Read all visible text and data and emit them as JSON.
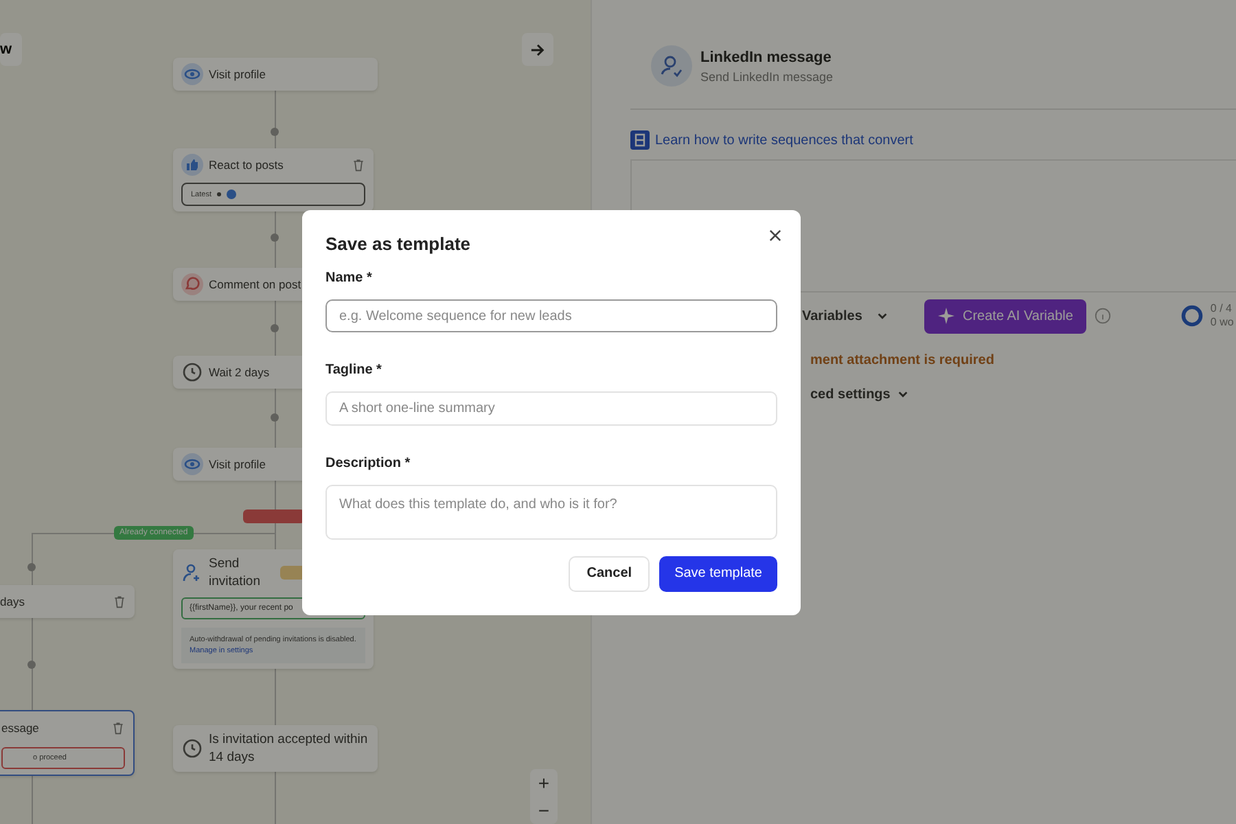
{
  "canvas": {
    "back_label": "w",
    "nodes": [
      {
        "kind": "visit",
        "label": "Visit profile"
      },
      {
        "kind": "react",
        "label": "React to posts",
        "deletable": true,
        "select": "Latest"
      },
      {
        "kind": "comment",
        "label": "Comment on post"
      },
      {
        "kind": "wait",
        "label": "Wait 2 days"
      },
      {
        "kind": "visit",
        "label": "Visit profile"
      },
      {
        "kind": "cut",
        "label": "days",
        "deletable": true,
        "selected": false
      },
      {
        "kind": "invite",
        "label": "Send invitation",
        "field": "{{firstName}}, your recent po",
        "note": "Auto-withdrawal of pending invitations is disabled.",
        "note_link": "Manage in settings"
      },
      {
        "kind": "cut",
        "label": "essage",
        "deletable": true,
        "selected": true,
        "error_field": "o proceed"
      },
      {
        "kind": "wait",
        "label": "Is invitation accepted within 14 days"
      }
    ],
    "branches": [
      {
        "kind": "connected",
        "label": "Already connected"
      },
      {
        "kind": "not_connected"
      }
    ],
    "zoom": [
      "+",
      "−"
    ]
  },
  "panel": {
    "title": "LinkedIn message",
    "subtitle": "Send LinkedIn message",
    "help_link": "Learn how to write sequences that convert",
    "variables": "Variables",
    "ai_button": "Create AI Variable",
    "counter_top": "0 / 4",
    "counter_bottom": "0 wo",
    "error": "ment attachment is required",
    "advanced": "ced settings"
  },
  "modal": {
    "title": "Save as template",
    "fields": [
      {
        "kind": "input",
        "label": "Name *",
        "placeholder": "e.g. Welcome sequence for new leads",
        "focused": true
      },
      {
        "kind": "input",
        "label": "Tagline *",
        "placeholder": "A short one-line summary",
        "focused": false
      },
      {
        "kind": "textarea",
        "label": "Description *",
        "placeholder": "What does this template do, and who is it for?",
        "focused": false
      }
    ],
    "buttons": [
      {
        "kind": "secondary",
        "label": "Cancel"
      },
      {
        "kind": "primary",
        "label": "Save template"
      }
    ]
  }
}
